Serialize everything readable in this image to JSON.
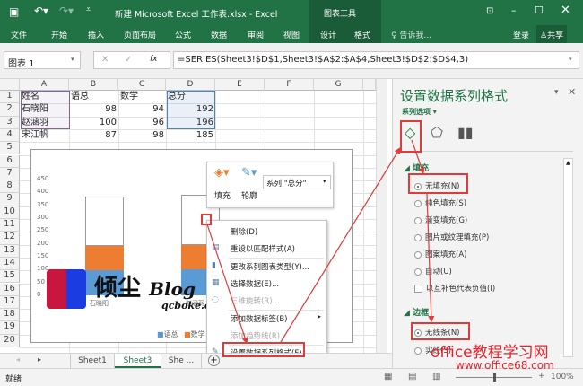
{
  "titlebar": {
    "title": "新建 Microsoft Excel 工作表.xlsx - Excel",
    "context_tab": "图表工具"
  },
  "ribbon": {
    "tabs": [
      "文件",
      "开始",
      "插入",
      "页面布局",
      "公式",
      "数据",
      "审阅",
      "视图",
      "设计",
      "格式"
    ],
    "tell_me": "告诉我...",
    "login": "登录",
    "share": "共享"
  },
  "formula_bar": {
    "name_box": "图表 1",
    "fx": "fx",
    "formula": "=SERIES(Sheet3!$D$1,Sheet3!$A$2:$A$4,Sheet3!$D$2:$D$4,3)"
  },
  "sheet": {
    "columns": [
      "A",
      "B",
      "C",
      "D",
      "E",
      "F",
      "G"
    ],
    "rows": [
      "1",
      "2",
      "3",
      "4",
      "5",
      "6",
      "7",
      "8",
      "9",
      "10",
      "11",
      "12",
      "13",
      "14",
      "15",
      "16",
      "17",
      "18",
      "19",
      "20"
    ],
    "headers": [
      "姓名",
      "语总",
      "数学",
      "总分"
    ],
    "data": [
      [
        "石晓阳",
        "98",
        "94",
        "192"
      ],
      [
        "赵涵羽",
        "100",
        "96",
        "196"
      ],
      [
        "宋江帆",
        "87",
        "98",
        "185"
      ]
    ]
  },
  "chart": {
    "y_ticks": [
      "450",
      "400",
      "350",
      "300",
      "250",
      "200",
      "150",
      "100",
      "50",
      "0"
    ],
    "categories": [
      "石晓阳",
      "赵涵羽"
    ],
    "legend": [
      "语总",
      "数学"
    ],
    "colors": {
      "blue": "#5b9bd5",
      "orange": "#ed7d31"
    },
    "values": {
      "语总": [
        98,
        100
      ],
      "数学": [
        94,
        96
      ],
      "总分": [
        192,
        196
      ]
    },
    "ymax": 450
  },
  "mini_toolbar": {
    "fill": "填充",
    "outline": "轮廓",
    "series_select": "系列 \"总分\""
  },
  "context_menu": [
    {
      "label": "删除(D)",
      "disabled": false
    },
    {
      "label": "重设以匹配样式(A)",
      "disabled": false
    },
    {
      "label": "更改系列图表类型(Y)...",
      "disabled": false
    },
    {
      "label": "选择数据(E)...",
      "disabled": false
    },
    {
      "label": "三维旋转(R)...",
      "disabled": true
    },
    {
      "label": "添加数据标签(B)",
      "disabled": false
    },
    {
      "label": "添加趋势线(R)...",
      "disabled": true
    },
    {
      "label": "设置数据系列格式(F)...",
      "disabled": false
    }
  ],
  "pane": {
    "title": "设置数据系列格式",
    "subtitle": "系列选项",
    "fill_section": "填充",
    "fill_options": [
      "无填充(N)",
      "纯色填充(S)",
      "渐变填充(G)",
      "图片或纹理填充(P)",
      "图案填充(A)",
      "自动(U)"
    ],
    "invert_checkbox": "以互补色代表负值(I)",
    "border_section": "边框",
    "border_options": [
      "无线条(N)",
      "实线(S)"
    ]
  },
  "sheet_tabs": [
    "Sheet1",
    "Sheet3",
    "She ..."
  ],
  "status": {
    "ready": "就绪",
    "zoom": "100%"
  },
  "watermarks": {
    "logo": "倾尘 Blog",
    "logo_url": "qcboke.com",
    "site": "office教程学习网",
    "site_url": "www.office68.com"
  }
}
